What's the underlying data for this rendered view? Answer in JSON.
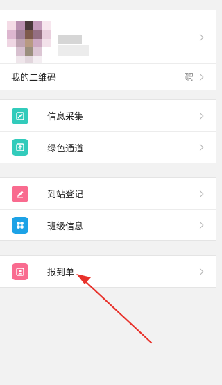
{
  "profile": {
    "avatar_icon": "pixelated-avatar",
    "name_icon": "blurred-name"
  },
  "qr": {
    "label": "我的二维码",
    "icon": "qr-code-icon"
  },
  "menu": {
    "group1": [
      {
        "label": "信息采集",
        "icon": "edit-form-icon",
        "color": "#32cbbb"
      },
      {
        "label": "绿色通道",
        "icon": "upload-box-icon",
        "color": "#32cbbb"
      }
    ],
    "group2": [
      {
        "label": "到站登记",
        "icon": "pencil-icon",
        "color": "#f96b8f"
      },
      {
        "label": "班级信息",
        "icon": "grid-icon",
        "color": "#1da2e6"
      }
    ],
    "group3": [
      {
        "label": "报到单",
        "icon": "badge-icon",
        "color": "#f96b8f"
      }
    ]
  },
  "annotation": {
    "arrow_color": "#e8312a"
  }
}
